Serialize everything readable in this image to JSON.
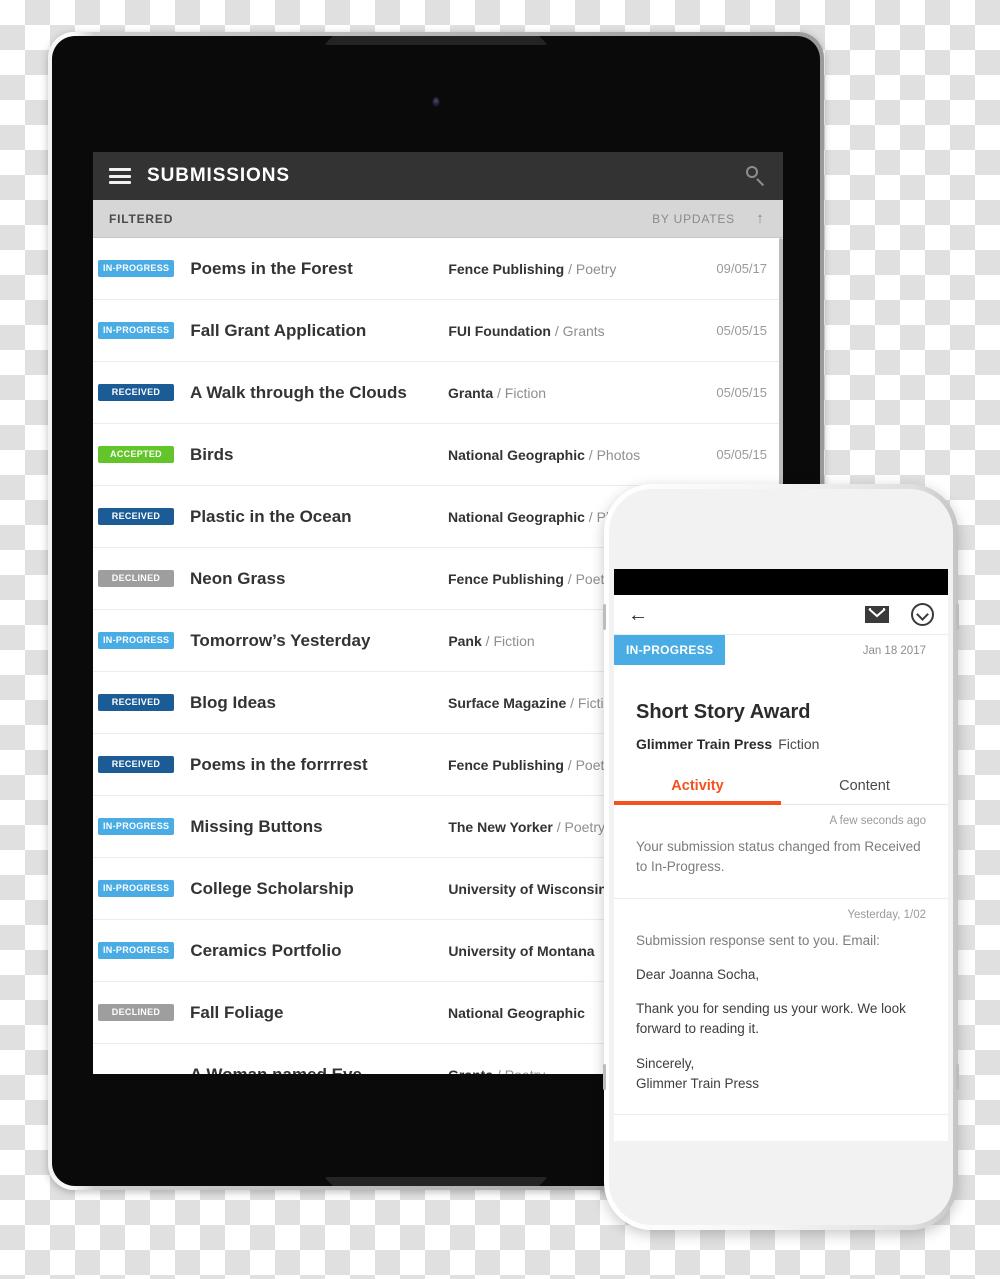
{
  "tablet": {
    "header": {
      "title": "SUBMISSIONS",
      "menu_icon": "hamburger-icon",
      "search_icon": "search-icon"
    },
    "filter_bar": {
      "filter_label": "FILTERED",
      "sort_label": "BY UPDATES",
      "sort_arrow": "↑"
    },
    "submissions": [
      {
        "status": "IN-PROGRESS",
        "status_class": "in-progress",
        "title": "Poems in the Forest",
        "publisher": "Fence Publishing",
        "category": "Poetry",
        "date": "09/05/17"
      },
      {
        "status": "IN-PROGRESS",
        "status_class": "in-progress",
        "title": "Fall Grant Application",
        "publisher": "FUI Foundation",
        "category": "Grants",
        "date": "05/05/15"
      },
      {
        "status": "RECEIVED",
        "status_class": "received",
        "title": "A Walk through the Clouds",
        "publisher": "Granta",
        "category": "Fiction",
        "date": "05/05/15"
      },
      {
        "status": "ACCEPTED",
        "status_class": "accepted",
        "title": "Birds",
        "publisher": "National Geographic",
        "category": "Photos",
        "date": "05/05/15"
      },
      {
        "status": "RECEIVED",
        "status_class": "received",
        "title": "Plastic in the Ocean",
        "publisher": "National Geographic",
        "category": "Photos",
        "date": ""
      },
      {
        "status": "DECLINED",
        "status_class": "declined",
        "title": "Neon Grass",
        "publisher": "Fence Publishing",
        "category": "Poetry",
        "date": ""
      },
      {
        "status": "IN-PROGRESS",
        "status_class": "in-progress",
        "title": "Tomorrow’s Yesterday",
        "publisher": "Pank",
        "category": "Fiction",
        "date": ""
      },
      {
        "status": "RECEIVED",
        "status_class": "received",
        "title": "Blog Ideas",
        "publisher": "Surface Magazine",
        "category": "Fiction",
        "date": ""
      },
      {
        "status": "RECEIVED",
        "status_class": "received",
        "title": "Poems in the forrrrest",
        "publisher": "Fence Publishing",
        "category": "Poetry",
        "date": ""
      },
      {
        "status": "IN-PROGRESS",
        "status_class": "in-progress",
        "title": "Missing Buttons",
        "publisher": "The New Yorker",
        "category": "Poetry",
        "date": ""
      },
      {
        "status": "IN-PROGRESS",
        "status_class": "in-progress",
        "title": "College Scholarship",
        "publisher": "University of Wisconsin",
        "category": "",
        "date": ""
      },
      {
        "status": "IN-PROGRESS",
        "status_class": "in-progress",
        "title": "Ceramics Portfolio",
        "publisher": "University of Montana",
        "category": "",
        "date": ""
      },
      {
        "status": "DECLINED",
        "status_class": "declined",
        "title": "Fall Foliage",
        "publisher": "National Geographic",
        "category": "",
        "date": ""
      },
      {
        "status": "",
        "status_class": "",
        "title": "A Woman named Eve",
        "publisher": "Granta",
        "category": "Poetry",
        "date": ""
      }
    ]
  },
  "phone": {
    "nav": {
      "back_icon": "back-arrow-icon",
      "mail_icon": "envelope-icon",
      "more_icon": "chevron-down-circle-icon"
    },
    "detail": {
      "status": "IN-PROGRESS",
      "date": "Jan 18 2017",
      "title": "Short Story Award",
      "publisher": "Glimmer Train Press",
      "category": "Fiction"
    },
    "tabs": [
      {
        "label": "Activity",
        "active": true
      },
      {
        "label": "Content",
        "active": false
      }
    ],
    "activity": [
      {
        "time": "A  few seconds ago",
        "lines": [
          {
            "text": "Your submission status changed from Received to In-Progress.",
            "tone": "muted"
          }
        ]
      },
      {
        "time": "Yesterday, 1/02",
        "lines": [
          {
            "text": "Submission response sent to you. Email:",
            "tone": "muted"
          },
          {
            "text": "Dear Joanna Socha,",
            "tone": "dark"
          },
          {
            "text": "Thank you for sending us your work. We look forward to reading it.",
            "tone": "dark"
          },
          {
            "text": "Sincerely,",
            "tone": "dark"
          },
          {
            "text": "Glimmer Train Press",
            "tone": "dark"
          }
        ]
      }
    ]
  },
  "colors": {
    "in_progress": "#49ace4",
    "received": "#1b5c96",
    "accepted": "#62c62b",
    "declined": "#9e9e9e",
    "accent_orange": "#f4511e",
    "header_dark": "#333333",
    "filter_bar": "#d6d6d6"
  }
}
